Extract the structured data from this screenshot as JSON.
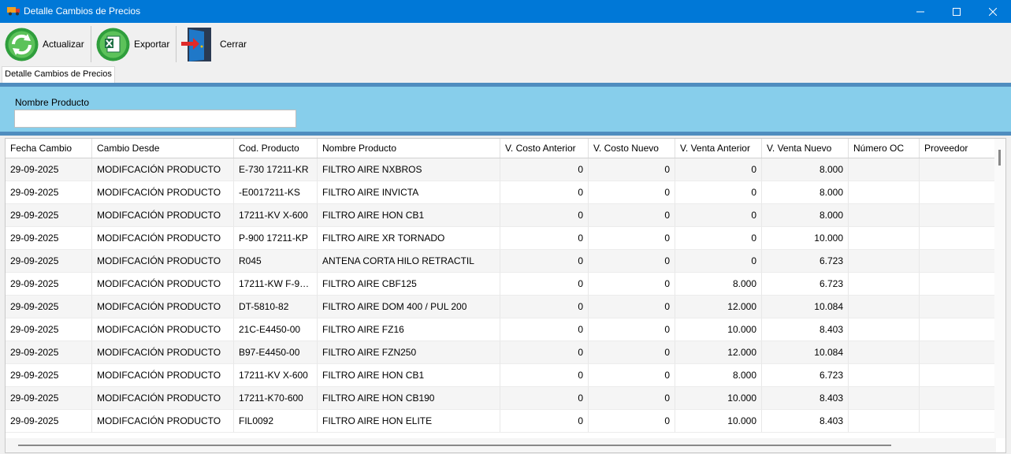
{
  "window": {
    "title": "Detalle Cambios de Precios"
  },
  "toolbar": {
    "refresh_label": "Actualizar",
    "export_label": "Exportar",
    "close_label": "Cerrar"
  },
  "tabs": [
    {
      "label": "Detalle Cambios de Precios"
    }
  ],
  "filter": {
    "label": "Nombre Producto",
    "value": ""
  },
  "grid": {
    "columns": [
      "Fecha Cambio",
      "Cambio Desde",
      "Cod. Producto",
      "Nombre Producto",
      "V. Costo Anterior",
      "V. Costo Nuevo",
      "V. Venta Anterior",
      "V. Venta Nuevo",
      "Número OC",
      "Proveedor"
    ],
    "rows": [
      [
        "29-09-2025",
        "MODIFCACIÓN PRODUCTO",
        "E-730 17211-KR",
        "FILTRO AIRE NXBROS",
        "0",
        "0",
        "0",
        "8.000",
        "",
        ""
      ],
      [
        "29-09-2025",
        "MODIFCACIÓN PRODUCTO",
        "-E0017211-KS",
        "FILTRO AIRE INVICTA",
        "0",
        "0",
        "0",
        "8.000",
        "",
        ""
      ],
      [
        "29-09-2025",
        "MODIFCACIÓN PRODUCTO",
        "17211-KV X-600",
        "FILTRO AIRE HON CB1",
        "0",
        "0",
        "0",
        "8.000",
        "",
        ""
      ],
      [
        "29-09-2025",
        "MODIFCACIÓN PRODUCTO",
        "P-900 17211-KP",
        "FILTRO AIRE XR TORNADO",
        "0",
        "0",
        "0",
        "10.000",
        "",
        ""
      ],
      [
        "29-09-2025",
        "MODIFCACIÓN PRODUCTO",
        "R045",
        "ANTENA CORTA HILO RETRACTIL",
        "0",
        "0",
        "0",
        "6.723",
        "",
        ""
      ],
      [
        "29-09-2025",
        "MODIFCACIÓN PRODUCTO",
        "17211-KW F-9…",
        "FILTRO AIRE CBF125",
        "0",
        "0",
        "8.000",
        "6.723",
        "",
        ""
      ],
      [
        "29-09-2025",
        "MODIFCACIÓN PRODUCTO",
        "DT-5810-82",
        "FILTRO AIRE DOM 400 / PUL 200",
        "0",
        "0",
        "12.000",
        "10.084",
        "",
        ""
      ],
      [
        "29-09-2025",
        "MODIFCACIÓN PRODUCTO",
        "21C-E4450-00",
        "FILTRO AIRE FZ16",
        "0",
        "0",
        "10.000",
        "8.403",
        "",
        ""
      ],
      [
        "29-09-2025",
        "MODIFCACIÓN PRODUCTO",
        "B97-E4450-00",
        "FILTRO AIRE FZN250",
        "0",
        "0",
        "12.000",
        "10.084",
        "",
        ""
      ],
      [
        "29-09-2025",
        "MODIFCACIÓN PRODUCTO",
        "17211-KV X-600",
        "FILTRO AIRE HON CB1",
        "0",
        "0",
        "8.000",
        "6.723",
        "",
        ""
      ],
      [
        "29-09-2025",
        "MODIFCACIÓN PRODUCTO",
        "17211-K70-600",
        "FILTRO AIRE HON CB190",
        "0",
        "0",
        "10.000",
        "8.403",
        "",
        ""
      ],
      [
        "29-09-2025",
        "MODIFCACIÓN PRODUCTO",
        "FIL0092",
        "FILTRO AIRE HON ELITE",
        "0",
        "0",
        "10.000",
        "8.403",
        "",
        ""
      ]
    ]
  }
}
